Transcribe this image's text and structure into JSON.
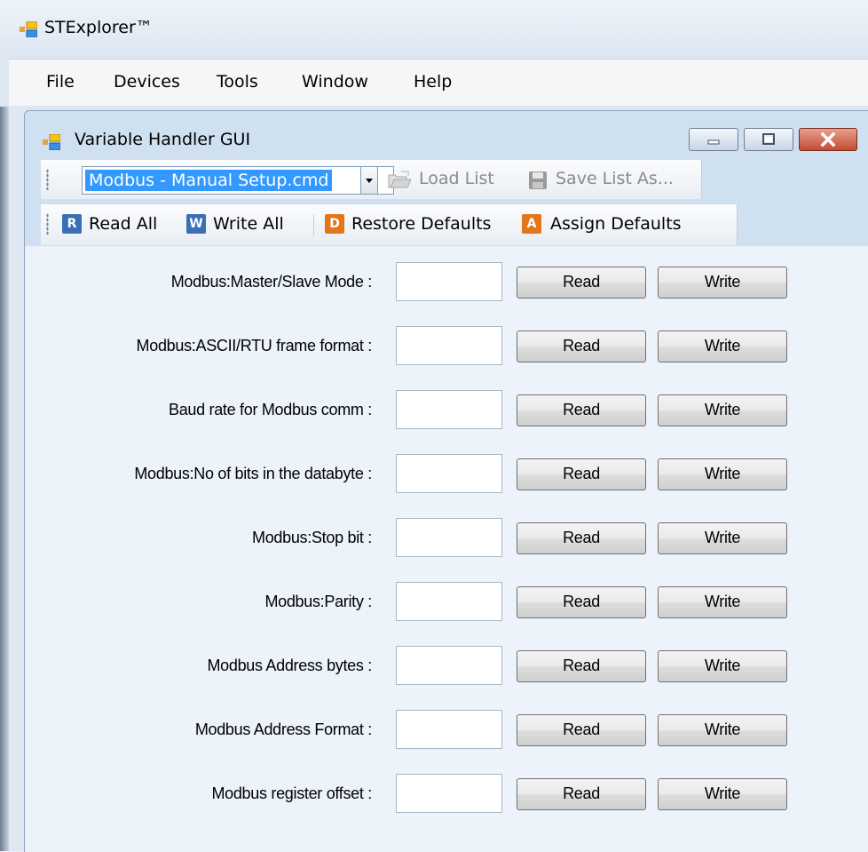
{
  "app": {
    "title": "STExplorer™"
  },
  "menu": [
    "File",
    "Devices",
    "Tools",
    "Window",
    "Help"
  ],
  "child": {
    "title": "Variable Handler GUI"
  },
  "toolbar1": {
    "combo_value": "Modbus - Manual Setup.cmd",
    "load_list": "Load List",
    "save_list_as": "Save List As..."
  },
  "toolbar2": {
    "read_all": "Read All",
    "write_all": "Write All",
    "restore_defaults": "Restore Defaults",
    "assign_defaults": "Assign Defaults",
    "read_icon_letter": "R",
    "write_icon_letter": "W",
    "restore_icon_letter": "D",
    "assign_icon_letter": "A"
  },
  "colors": {
    "read_icon": "#3a6fb6",
    "write_icon": "#3a6fb6",
    "restore_icon": "#e3761a",
    "assign_icon": "#e3761a",
    "selection": "#3399ff"
  },
  "rows": [
    {
      "label": "Modbus:Master/Slave Mode :",
      "value": "",
      "read": "Read",
      "write": "Write"
    },
    {
      "label": "Modbus:ASCII/RTU frame format :",
      "value": "",
      "read": "Read",
      "write": "Write"
    },
    {
      "label": "Baud rate for Modbus comm :",
      "value": "",
      "read": "Read",
      "write": "Write"
    },
    {
      "label": "Modbus:No of bits in the databyte :",
      "value": "",
      "read": "Read",
      "write": "Write"
    },
    {
      "label": "Modbus:Stop bit :",
      "value": "",
      "read": "Read",
      "write": "Write"
    },
    {
      "label": "Modbus:Parity :",
      "value": "",
      "read": "Read",
      "write": "Write"
    },
    {
      "label": "Modbus Address bytes :",
      "value": "",
      "read": "Read",
      "write": "Write"
    },
    {
      "label": "Modbus Address Format :",
      "value": "",
      "read": "Read",
      "write": "Write"
    },
    {
      "label": "Modbus register offset :",
      "value": "",
      "read": "Read",
      "write": "Write"
    }
  ]
}
